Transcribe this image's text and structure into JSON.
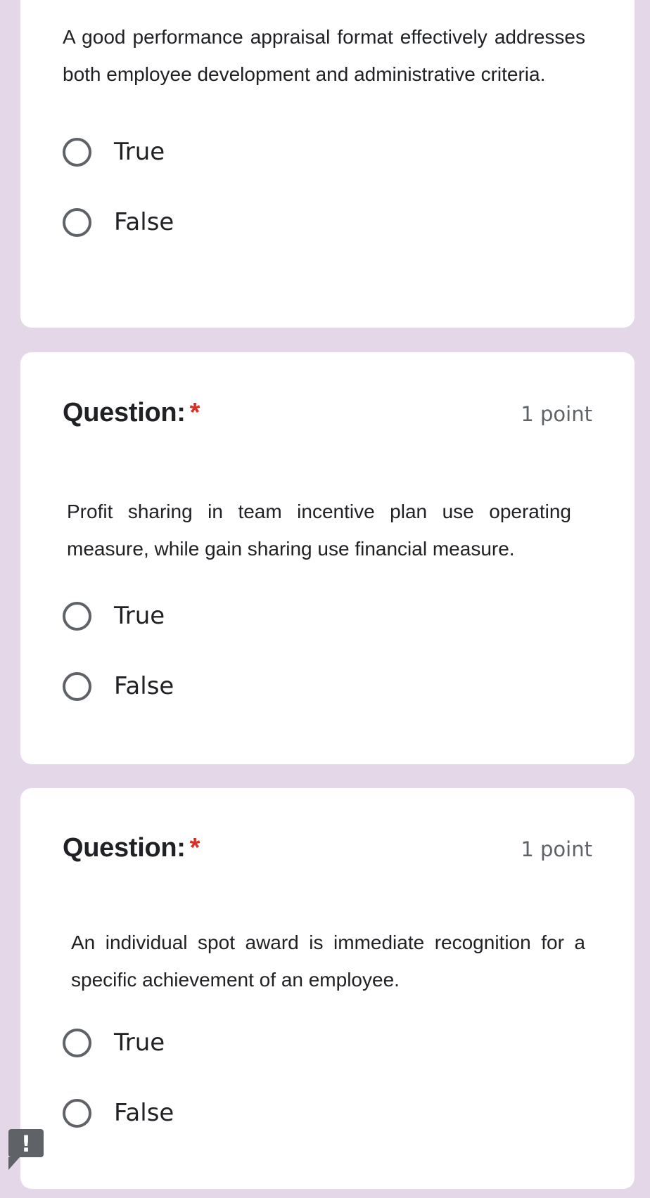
{
  "questions": [
    {
      "text": "A good performance appraisal format effectively addresses both employee development and administrative criteria.",
      "options": [
        "True",
        "False"
      ]
    },
    {
      "title": "Question:",
      "required_mark": "*",
      "points": "1 point",
      "text": "Profit sharing in team incentive plan use operating measure, while gain sharing use financial measure.",
      "options": [
        "True",
        "False"
      ]
    },
    {
      "title": "Question:",
      "required_mark": "*",
      "points": "1 point",
      "text": "An individual spot award is immediate recognition for a specific achievement of an employee.",
      "options": [
        "True",
        "False"
      ]
    }
  ],
  "report_button": {
    "icon": "exclamation-icon",
    "glyph": "!"
  }
}
